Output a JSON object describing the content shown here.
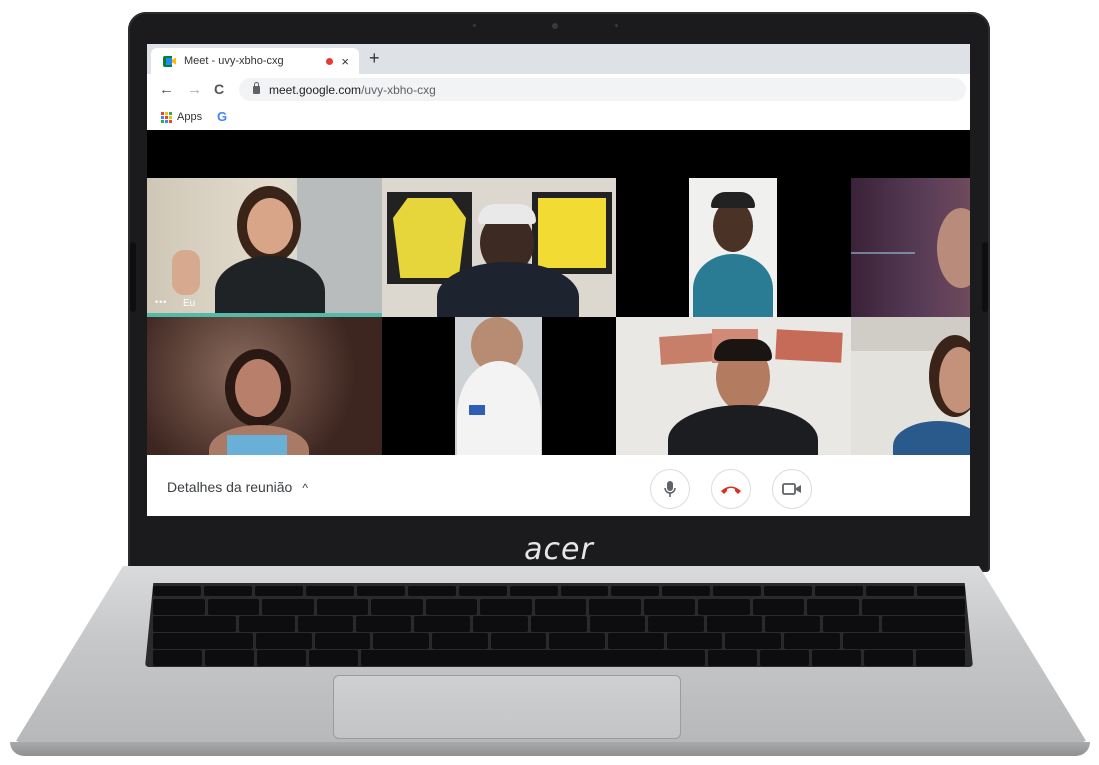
{
  "browser": {
    "tab_title": "Meet - uvy-xbho-cxg",
    "tab_close": "×",
    "new_tab": "+",
    "back": "←",
    "forward": "→",
    "reload": "C",
    "url_host": "meet.google.com",
    "url_path": "/uvy-xbho-cxg",
    "bookmarks": {
      "apps_label": "Apps",
      "google_label": "G"
    }
  },
  "meeting": {
    "self_label": "Eu",
    "self_menu": "•••",
    "details_label": "Detalhes da reunião",
    "details_chevron": "^"
  },
  "device": {
    "brand": "acer"
  },
  "colors": {
    "hangup": "#d93025",
    "active_speaker": "#53b9a8",
    "meet_green": "#00832d",
    "meet_yellow": "#ffba00",
    "meet_blue": "#2684fc"
  }
}
